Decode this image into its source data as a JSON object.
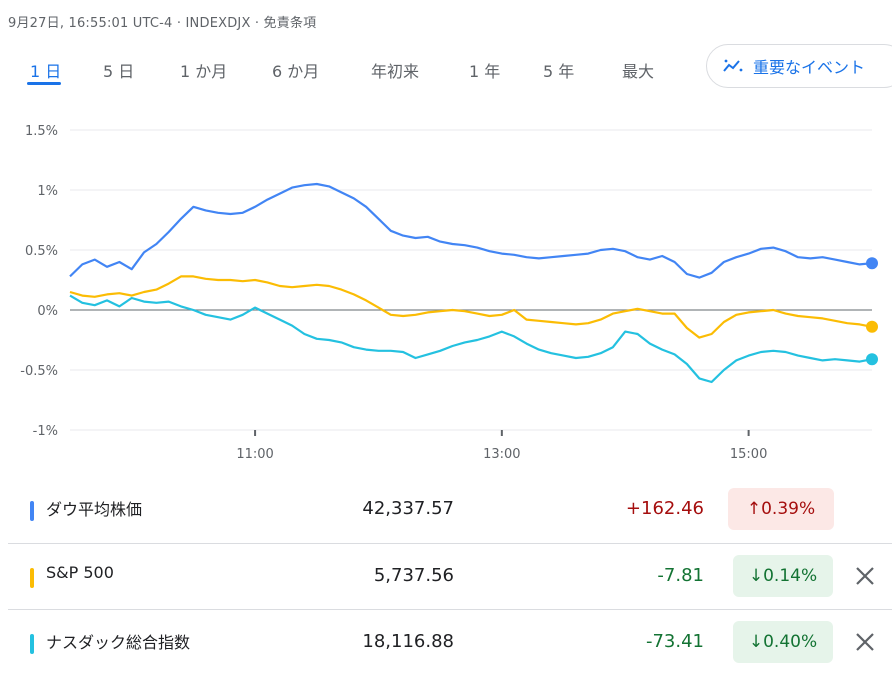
{
  "header": {
    "subtitle": "9月27日, 16:55:01 UTC-4 · INDEXDJX · 免責条項"
  },
  "tabs": [
    {
      "label": "1 日",
      "active": true
    },
    {
      "label": "5 日",
      "active": false
    },
    {
      "label": "1 か月",
      "active": false
    },
    {
      "label": "6 か月",
      "active": false
    },
    {
      "label": "年初来",
      "active": false
    },
    {
      "label": "1 年",
      "active": false
    },
    {
      "label": "5 年",
      "active": false
    },
    {
      "label": "最大",
      "active": false
    }
  ],
  "events_button": {
    "label": "重要なイベント",
    "icon": "trend-icon"
  },
  "colors": {
    "dow": "#4285f4",
    "sp": "#fbbc04",
    "nasdaq": "#24c1e0",
    "up_text": "#a50e0e",
    "up_bg": "#fce8e6",
    "down_text": "#137333",
    "down_bg": "#e6f4ea",
    "accent": "#1a73e8"
  },
  "chart_data": {
    "type": "line",
    "ylabel": "",
    "xlabel": "",
    "yticks": [
      "1.5%",
      "1%",
      "0.5%",
      "0%",
      "-0.5%",
      "-1%"
    ],
    "ytick_values": [
      1.5,
      1.0,
      0.5,
      0.0,
      -0.5,
      -1.0
    ],
    "ylim": [
      -1.0,
      1.5
    ],
    "xticks": [
      "11:00",
      "13:00",
      "15:00"
    ],
    "xtick_values": [
      11.0,
      13.0,
      15.0
    ],
    "xlim": [
      9.5,
      16.0
    ],
    "grid": true,
    "series": [
      {
        "name": "ダウ平均株価",
        "color_key": "dow",
        "x": [
          9.5,
          9.6,
          9.7,
          9.8,
          9.9,
          10.0,
          10.1,
          10.2,
          10.3,
          10.4,
          10.5,
          10.6,
          10.7,
          10.8,
          10.9,
          11.0,
          11.1,
          11.2,
          11.3,
          11.4,
          11.5,
          11.6,
          11.7,
          11.8,
          11.9,
          12.0,
          12.1,
          12.2,
          12.3,
          12.4,
          12.5,
          12.6,
          12.7,
          12.8,
          12.9,
          13.0,
          13.1,
          13.2,
          13.3,
          13.4,
          13.5,
          13.6,
          13.7,
          13.8,
          13.9,
          14.0,
          14.1,
          14.2,
          14.3,
          14.4,
          14.5,
          14.6,
          14.7,
          14.8,
          14.9,
          15.0,
          15.1,
          15.2,
          15.3,
          15.4,
          15.5,
          15.6,
          15.7,
          15.8,
          15.9,
          16.0
        ],
        "values": [
          0.28,
          0.38,
          0.42,
          0.36,
          0.4,
          0.34,
          0.48,
          0.55,
          0.65,
          0.76,
          0.86,
          0.83,
          0.81,
          0.8,
          0.81,
          0.86,
          0.92,
          0.97,
          1.02,
          1.04,
          1.05,
          1.03,
          0.98,
          0.93,
          0.86,
          0.76,
          0.66,
          0.62,
          0.6,
          0.61,
          0.57,
          0.55,
          0.54,
          0.52,
          0.49,
          0.47,
          0.46,
          0.44,
          0.43,
          0.44,
          0.45,
          0.46,
          0.47,
          0.5,
          0.51,
          0.49,
          0.44,
          0.42,
          0.45,
          0.4,
          0.3,
          0.27,
          0.31,
          0.4,
          0.44,
          0.47,
          0.51,
          0.52,
          0.49,
          0.44,
          0.43,
          0.44,
          0.42,
          0.4,
          0.38,
          0.39
        ]
      },
      {
        "name": "S&P 500",
        "color_key": "sp",
        "x": [
          9.5,
          9.6,
          9.7,
          9.8,
          9.9,
          10.0,
          10.1,
          10.2,
          10.3,
          10.4,
          10.5,
          10.6,
          10.7,
          10.8,
          10.9,
          11.0,
          11.1,
          11.2,
          11.3,
          11.4,
          11.5,
          11.6,
          11.7,
          11.8,
          11.9,
          12.0,
          12.1,
          12.2,
          12.3,
          12.4,
          12.5,
          12.6,
          12.7,
          12.8,
          12.9,
          13.0,
          13.1,
          13.2,
          13.3,
          13.4,
          13.5,
          13.6,
          13.7,
          13.8,
          13.9,
          14.0,
          14.1,
          14.2,
          14.3,
          14.4,
          14.5,
          14.6,
          14.7,
          14.8,
          14.9,
          15.0,
          15.1,
          15.2,
          15.3,
          15.4,
          15.5,
          15.6,
          15.7,
          15.8,
          15.9,
          16.0
        ],
        "values": [
          0.15,
          0.12,
          0.11,
          0.13,
          0.14,
          0.12,
          0.15,
          0.17,
          0.22,
          0.28,
          0.28,
          0.26,
          0.25,
          0.25,
          0.24,
          0.25,
          0.23,
          0.2,
          0.19,
          0.2,
          0.21,
          0.2,
          0.17,
          0.13,
          0.08,
          0.02,
          -0.04,
          -0.05,
          -0.04,
          -0.02,
          -0.01,
          0.0,
          -0.01,
          -0.03,
          -0.05,
          -0.04,
          0.0,
          -0.08,
          -0.09,
          -0.1,
          -0.11,
          -0.12,
          -0.11,
          -0.08,
          -0.03,
          -0.01,
          0.01,
          -0.01,
          -0.03,
          -0.03,
          -0.15,
          -0.23,
          -0.2,
          -0.1,
          -0.04,
          -0.02,
          -0.01,
          0.0,
          -0.03,
          -0.05,
          -0.06,
          -0.07,
          -0.09,
          -0.11,
          -0.12,
          -0.14
        ]
      },
      {
        "name": "ナスダック総合指数",
        "color_key": "nasdaq",
        "x": [
          9.5,
          9.6,
          9.7,
          9.8,
          9.9,
          10.0,
          10.1,
          10.2,
          10.3,
          10.4,
          10.5,
          10.6,
          10.7,
          10.8,
          10.9,
          11.0,
          11.1,
          11.2,
          11.3,
          11.4,
          11.5,
          11.6,
          11.7,
          11.8,
          11.9,
          12.0,
          12.1,
          12.2,
          12.3,
          12.4,
          12.5,
          12.6,
          12.7,
          12.8,
          12.9,
          13.0,
          13.1,
          13.2,
          13.3,
          13.4,
          13.5,
          13.6,
          13.7,
          13.8,
          13.9,
          14.0,
          14.1,
          14.2,
          14.3,
          14.4,
          14.5,
          14.6,
          14.7,
          14.8,
          14.9,
          15.0,
          15.1,
          15.2,
          15.3,
          15.4,
          15.5,
          15.6,
          15.7,
          15.8,
          15.9,
          16.0
        ],
        "values": [
          0.12,
          0.06,
          0.04,
          0.08,
          0.03,
          0.1,
          0.07,
          0.06,
          0.07,
          0.03,
          0.0,
          -0.04,
          -0.06,
          -0.08,
          -0.04,
          0.02,
          -0.03,
          -0.08,
          -0.13,
          -0.2,
          -0.24,
          -0.25,
          -0.27,
          -0.31,
          -0.33,
          -0.34,
          -0.34,
          -0.35,
          -0.4,
          -0.37,
          -0.34,
          -0.3,
          -0.27,
          -0.25,
          -0.22,
          -0.18,
          -0.22,
          -0.28,
          -0.33,
          -0.36,
          -0.38,
          -0.4,
          -0.39,
          -0.36,
          -0.31,
          -0.18,
          -0.2,
          -0.28,
          -0.33,
          -0.37,
          -0.45,
          -0.57,
          -0.6,
          -0.5,
          -0.42,
          -0.38,
          -0.35,
          -0.34,
          -0.35,
          -0.38,
          -0.4,
          -0.42,
          -0.41,
          -0.42,
          -0.43,
          -0.41
        ]
      }
    ]
  },
  "table": {
    "rows": [
      {
        "name": "ダウ平均株価",
        "price": "42,337.57",
        "change": "+162.46",
        "pct": "0.39%",
        "direction": "up",
        "arrow": "↑",
        "color_key": "dow",
        "closable": false
      },
      {
        "name": "S&P 500",
        "price": "5,737.56",
        "change": "-7.81",
        "pct": "0.14%",
        "direction": "down",
        "arrow": "↓",
        "color_key": "sp",
        "closable": true
      },
      {
        "name": "ナスダック総合指数",
        "price": "18,116.88",
        "change": "-73.41",
        "pct": "0.40%",
        "direction": "down",
        "arrow": "↓",
        "color_key": "nasdaq",
        "closable": true
      }
    ]
  }
}
